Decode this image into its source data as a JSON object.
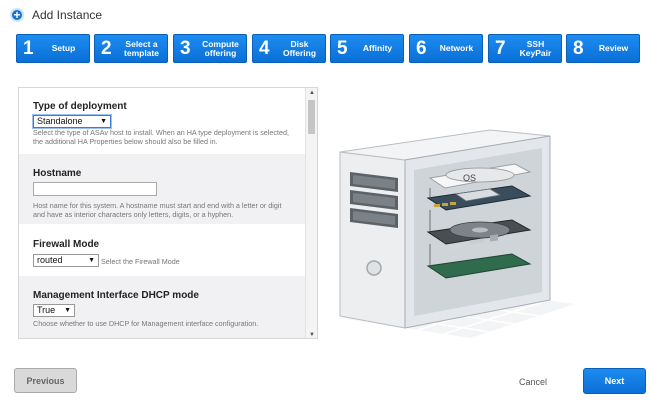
{
  "header": {
    "icon": "plus-circle-icon",
    "title": "Add Instance"
  },
  "steps": [
    {
      "num": "1",
      "label": "Setup"
    },
    {
      "num": "2",
      "label": "Select a template"
    },
    {
      "num": "3",
      "label": "Compute offering"
    },
    {
      "num": "4",
      "label": "Disk Offering"
    },
    {
      "num": "5",
      "label": "Affinity"
    },
    {
      "num": "6",
      "label": "Network"
    },
    {
      "num": "7",
      "label": "SSH KeyPair"
    },
    {
      "num": "8",
      "label": "Review"
    }
  ],
  "form": {
    "deployment": {
      "label": "Type of deployment",
      "value": "Standalone",
      "description": "Select the type of ASAv host to install. When an HA type deployment is selected, the additional HA Properties below should also be filled in."
    },
    "hostname": {
      "label": "Hostname",
      "value": "",
      "description": "Host name for this system. A hostname must start and end with a letter or digit and have as interior characters only letters, digits, or a hyphen."
    },
    "firewall": {
      "label": "Firewall Mode",
      "value": "routed",
      "description": "Select the Firewall Mode"
    },
    "dhcp": {
      "label": "Management Interface DHCP mode",
      "value": "True",
      "description": "Choose whether to use DHCP for Management interface configuration."
    }
  },
  "illustration": {
    "os_label": "OS"
  },
  "footer": {
    "previous": "Previous",
    "cancel": "Cancel",
    "next": "Next"
  },
  "colors": {
    "accent": "#0a6fd6",
    "panel_gray": "#f1f1f4"
  }
}
